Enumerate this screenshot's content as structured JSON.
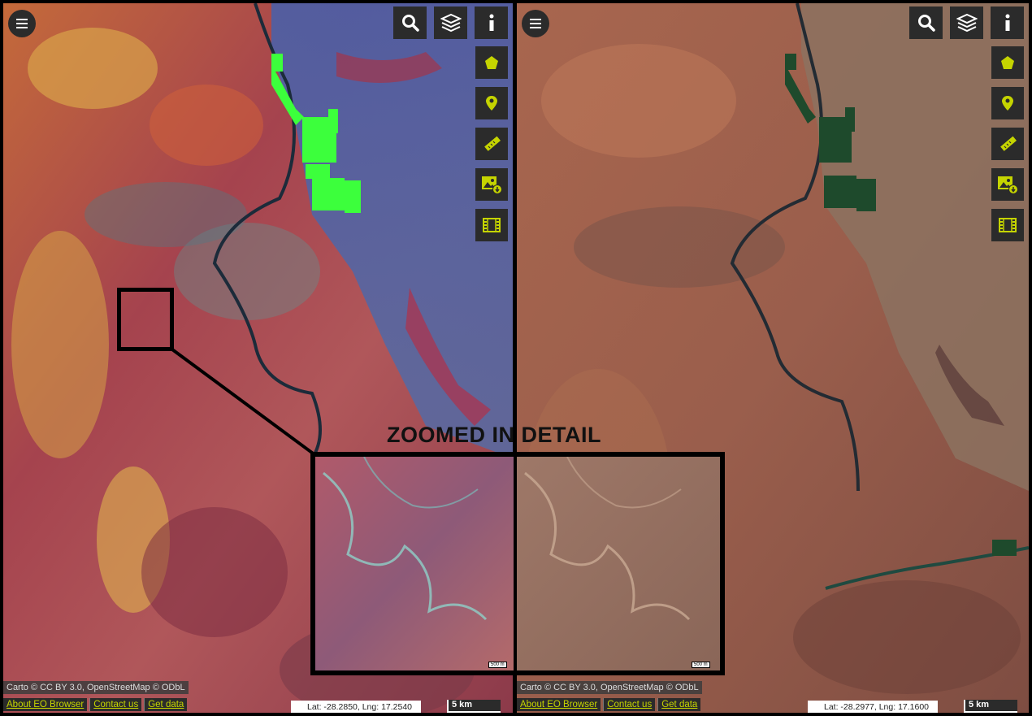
{
  "left_panel": {
    "menu_icon": "hamburger-menu-icon",
    "tools_top": [
      "search-icon",
      "layers-icon",
      "info-icon"
    ],
    "tools_side": [
      "polygon-icon",
      "pin-icon",
      "ruler-icon",
      "image-download-icon",
      "film-icon"
    ],
    "attribution": "Carto © CC BY 3.0, OpenStreetMap © ODbL",
    "links": [
      "About EO Browser",
      "Contact us",
      "Get data"
    ],
    "coords": "Lat: -28.2850, Lng: 17.2540",
    "scale": "5 km"
  },
  "right_panel": {
    "menu_icon": "hamburger-menu-icon",
    "tools_top": [
      "search-icon",
      "layers-icon",
      "info-icon"
    ],
    "tools_side": [
      "polygon-icon",
      "pin-icon",
      "ruler-icon",
      "image-download-icon",
      "film-icon"
    ],
    "attribution": "Carto © CC BY 3.0, OpenStreetMap © ODbL",
    "links": [
      "About EO Browser",
      "Contact us",
      "Get data"
    ],
    "coords": "Lat: -28.2977, Lng: 17.1600",
    "scale": "5 km"
  },
  "zoom": {
    "title": "ZOOMED IN DETAIL",
    "mini_scale": "500 m"
  },
  "colors": {
    "accent": "#c5d400",
    "button_bg": "#2b2b2b",
    "farmland_left": "#3cff3c",
    "farmland_right": "#1e4a2c"
  }
}
